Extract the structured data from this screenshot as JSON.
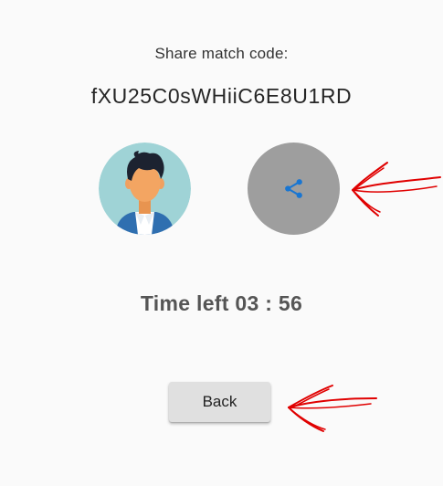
{
  "share": {
    "label": "Share match code:",
    "code": "fXU25C0sWHiiC6E8U1RD",
    "button_icon": "share-icon"
  },
  "avatar": {
    "icon": "person-avatar"
  },
  "timer": {
    "text": "Time left 03 : 56"
  },
  "actions": {
    "back_label": "Back"
  },
  "colors": {
    "background": "#fafafa",
    "share_circle": "#9e9e9e",
    "share_icon": "#1976d2",
    "avatar_bg": "#9fd3d6",
    "button_bg": "#e0e0e0",
    "annotation": "#e00000"
  }
}
